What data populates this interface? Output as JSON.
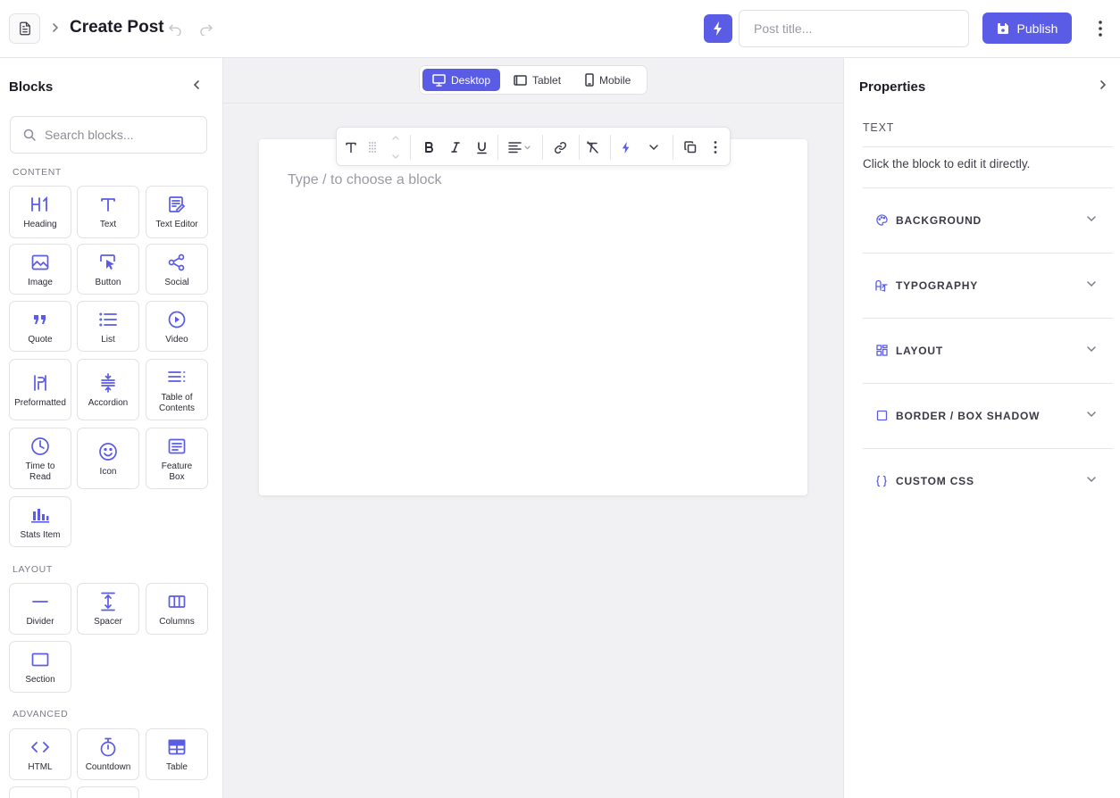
{
  "header": {
    "title": "Create Post",
    "title_placeholder": "Post title...",
    "publish_label": "Publish"
  },
  "colors": {
    "accent": "#5b5ce6",
    "canvas_bg": "#f1f1f3"
  },
  "left_panel": {
    "title": "Blocks",
    "search_placeholder": "Search blocks...",
    "sections": {
      "content": "CONTENT",
      "layout": "LAYOUT",
      "advanced": "ADVANCED"
    },
    "content_blocks": [
      {
        "label": "Heading",
        "icon": "heading-icon"
      },
      {
        "label": "Text",
        "icon": "text-icon"
      },
      {
        "label": "Text Editor",
        "icon": "text-editor-icon"
      },
      {
        "label": "Image",
        "icon": "image-icon"
      },
      {
        "label": "Button",
        "icon": "button-icon"
      },
      {
        "label": "Social",
        "icon": "share-icon"
      },
      {
        "label": "Quote",
        "icon": "quote-icon"
      },
      {
        "label": "List",
        "icon": "list-icon"
      },
      {
        "label": "Video",
        "icon": "play-icon"
      },
      {
        "label": "Preformatted",
        "icon": "preformatted-icon"
      },
      {
        "label": "Accordion",
        "icon": "accordion-icon"
      },
      {
        "label": "Table of Contents",
        "icon": "toc-icon"
      },
      {
        "label": "Time to Read",
        "icon": "clock-icon"
      },
      {
        "label": "Icon",
        "icon": "smiley-icon"
      },
      {
        "label": "Feature Box",
        "icon": "feature-box-icon"
      },
      {
        "label": "Stats Item",
        "icon": "stats-icon"
      }
    ],
    "layout_blocks": [
      {
        "label": "Divider",
        "icon": "divider-icon"
      },
      {
        "label": "Spacer",
        "icon": "spacer-icon"
      },
      {
        "label": "Columns",
        "icon": "columns-icon"
      },
      {
        "label": "Section",
        "icon": "section-icon"
      }
    ],
    "advanced_blocks": [
      {
        "label": "HTML",
        "icon": "code-icon"
      },
      {
        "label": "Countdown",
        "icon": "stopwatch-icon"
      },
      {
        "label": "Table",
        "icon": "table-icon"
      }
    ]
  },
  "canvas": {
    "devices": [
      {
        "label": "Desktop",
        "icon": "monitor-icon",
        "active": true
      },
      {
        "label": "Tablet",
        "icon": "tablet-icon",
        "active": false
      },
      {
        "label": "Mobile",
        "icon": "phone-icon",
        "active": false
      }
    ],
    "placeholder": "Type / to choose a block"
  },
  "right_panel": {
    "title": "Properties",
    "section_title": "TEXT",
    "hint": "Click the block to edit it directly.",
    "accordions": [
      {
        "label": "BACKGROUND",
        "icon": "palette-icon"
      },
      {
        "label": "TYPOGRAPHY",
        "icon": "typography-icon"
      },
      {
        "label": "LAYOUT",
        "icon": "layout-grid-icon"
      },
      {
        "label": "BORDER / BOX SHADOW",
        "icon": "border-icon"
      },
      {
        "label": "CUSTOM CSS",
        "icon": "braces-icon"
      }
    ]
  }
}
